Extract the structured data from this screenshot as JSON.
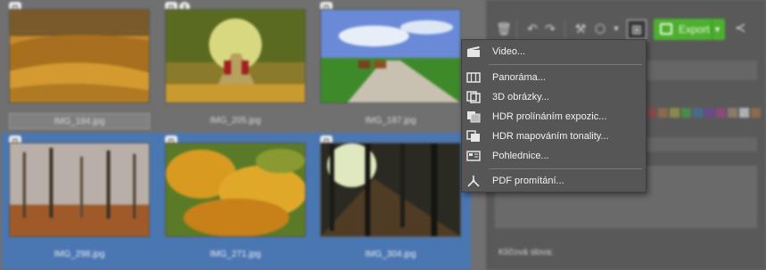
{
  "gallery": {
    "thumbnails": [
      {
        "name": "IMG_184.jpg",
        "selected": false,
        "badges": [
          "camera-icon"
        ]
      },
      {
        "name": "IMG_205.jpg",
        "selected": false,
        "badges": [
          "camera-icon",
          "info-icon"
        ]
      },
      {
        "name": "IMG_187.jpg",
        "selected": false,
        "badges": [
          "camera-icon"
        ]
      },
      {
        "name": "IMG_298.jpg",
        "selected": true,
        "badges": [
          "camera-icon"
        ]
      },
      {
        "name": "IMG_271.jpg",
        "selected": true,
        "badges": [
          "camera-icon"
        ]
      },
      {
        "name": "IMG_304.jpg",
        "selected": true,
        "badges": [
          "camera-icon"
        ]
      }
    ],
    "selection_color": "#4a76b2"
  },
  "toolbar": {
    "export_label": "Export",
    "export_color": "#4caf2f",
    "icons": [
      "trash-icon",
      "rotate-left-icon",
      "rotate-right-icon",
      "wrench-icon",
      "eraser-icon",
      "chevron-down-icon",
      "add-composite-icon",
      "share-icon"
    ]
  },
  "side_panel": {
    "keywords_label": "Klíčová slova:",
    "color_labels": [
      "#8a4a4a",
      "#8a6a4a",
      "#8a8a4a",
      "#4a8a4a",
      "#4a6a8a",
      "#6a4a8a",
      "#8a4a7a",
      "#8a7a6a",
      "#b0b0b0",
      "#8a6a50"
    ]
  },
  "menu": {
    "items": [
      {
        "label": "Video...",
        "icon": "video-clapper-icon"
      },
      {
        "label": "Panoráma...",
        "icon": "panorama-icon"
      },
      {
        "label": "3D obrázky...",
        "icon": "3d-images-icon"
      },
      {
        "label": "HDR prolínáním expozic...",
        "icon": "hdr-exposure-blend-icon"
      },
      {
        "label": "HDR mapováním tonality...",
        "icon": "hdr-tone-mapping-icon"
      },
      {
        "label": "Pohlednice...",
        "icon": "postcard-icon"
      },
      {
        "label": "PDF promítání...",
        "icon": "pdf-slideshow-icon"
      }
    ]
  }
}
